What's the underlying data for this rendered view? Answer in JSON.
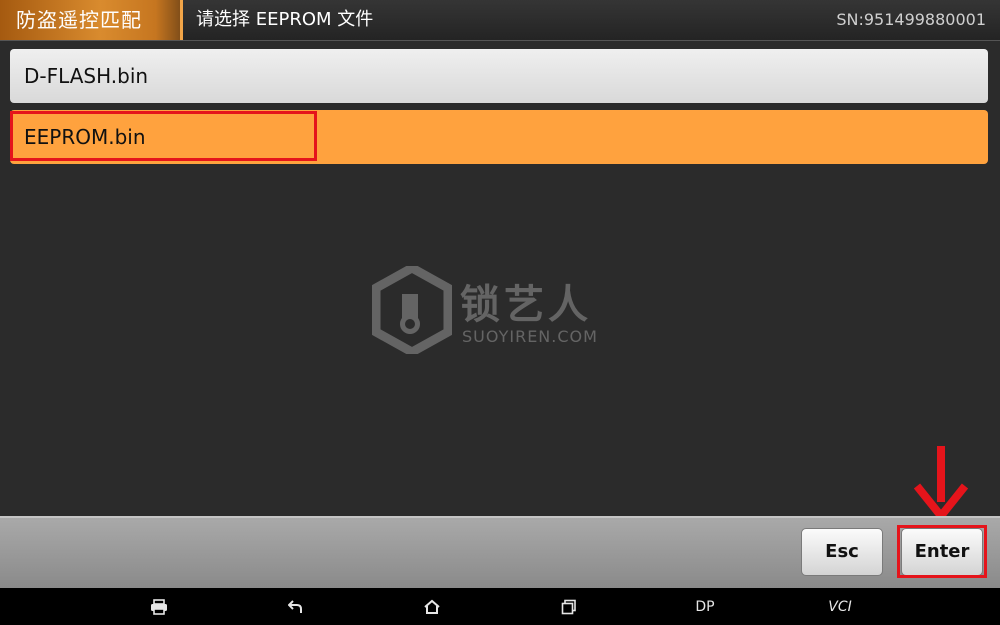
{
  "header": {
    "tab_label": "防盗遥控匹配",
    "title": "请选择 EEPROM 文件",
    "serial": "SN:951499880001"
  },
  "file_list": [
    {
      "label": "D-FLASH.bin",
      "selected": false
    },
    {
      "label": "EEPROM.bin",
      "selected": true
    }
  ],
  "watermark": {
    "cn_text": "锁艺人",
    "en_text": "SUOYIREN.COM"
  },
  "action_bar": {
    "esc_label": "Esc",
    "enter_label": "Enter"
  },
  "nav_bar": {
    "items": [
      {
        "name": "printer-icon"
      },
      {
        "name": "back-icon"
      },
      {
        "name": "home-icon"
      },
      {
        "name": "recent-apps-icon"
      },
      {
        "name": "dp-label",
        "label": "DP"
      },
      {
        "name": "vci-label",
        "label": "VCI"
      }
    ]
  },
  "colors": {
    "selected_row": "#ffa23e",
    "highlight_border": "#e5141b",
    "header_accent": "#d98b2e"
  }
}
